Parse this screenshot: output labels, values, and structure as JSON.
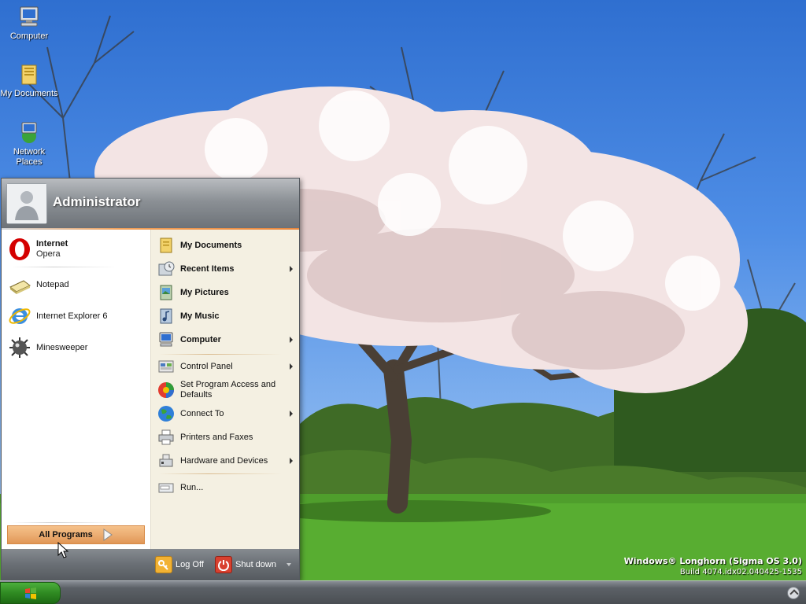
{
  "desktop": {
    "icons": [
      {
        "label": "Computer",
        "icon": "computer-icon"
      },
      {
        "label": "My Documents",
        "icon": "my-documents-icon"
      },
      {
        "label": "Network Places",
        "icon": "network-places-icon"
      }
    ],
    "branding": {
      "line1": "Windows® Longhorn (Sigma OS 3.0)",
      "line2": "Build 4074.idx02.040425-1535"
    }
  },
  "start_menu": {
    "user_name": "Administrator",
    "pinned": [
      {
        "title": "Internet",
        "subtitle": "Opera",
        "icon": "opera-icon"
      }
    ],
    "recent": [
      {
        "label": "Notepad",
        "icon": "notepad-icon"
      },
      {
        "label": "Internet Explorer 6",
        "icon": "internet-explorer-icon"
      },
      {
        "label": "Minesweeper",
        "icon": "minesweeper-icon"
      }
    ],
    "all_programs_label": "All Programs",
    "places": [
      {
        "label": "My Documents",
        "icon": "my-documents-icon",
        "submenu": false
      },
      {
        "label": "Recent Items",
        "icon": "recent-items-icon",
        "submenu": true
      },
      {
        "label": "My Pictures",
        "icon": "my-pictures-icon",
        "submenu": false
      },
      {
        "label": "My Music",
        "icon": "my-music-icon",
        "submenu": false
      },
      {
        "label": "Computer",
        "icon": "computer-icon",
        "submenu": true
      }
    ],
    "system": [
      {
        "label": "Control Panel",
        "icon": "control-panel-icon",
        "submenu": true
      },
      {
        "label": "Set Program Access and Defaults",
        "icon": "program-access-icon",
        "submenu": false
      },
      {
        "label": "Connect To",
        "icon": "connect-to-icon",
        "submenu": true
      },
      {
        "label": "Printers and Faxes",
        "icon": "printer-icon",
        "submenu": false
      },
      {
        "label": "Hardware and Devices",
        "icon": "hardware-icon",
        "submenu": true
      }
    ],
    "run_label": "Run...",
    "log_off_label": "Log Off",
    "shut_down_label": "Shut down"
  },
  "colors": {
    "accent_orange": "#e8873e",
    "start_green": "#2f8a22",
    "menu_right_bg": "#f4f0e2"
  }
}
